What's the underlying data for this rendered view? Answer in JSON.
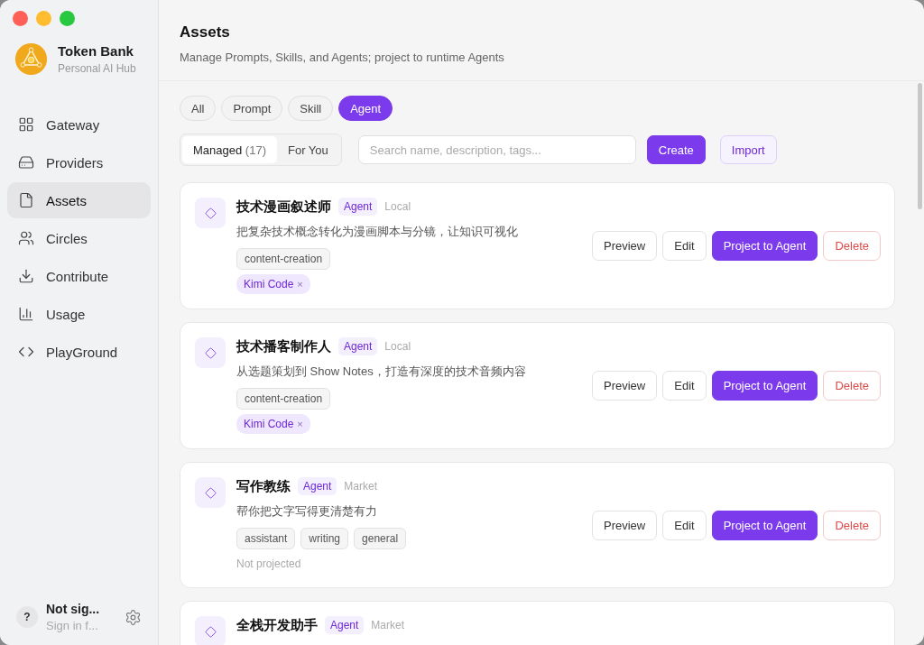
{
  "app": {
    "name": "Token Bank",
    "subtitle": "Personal AI Hub"
  },
  "sidebar": {
    "items": [
      {
        "label": "Gateway",
        "selected": false
      },
      {
        "label": "Providers",
        "selected": false
      },
      {
        "label": "Assets",
        "selected": true
      },
      {
        "label": "Circles",
        "selected": false
      },
      {
        "label": "Contribute",
        "selected": false
      },
      {
        "label": "Usage",
        "selected": false
      },
      {
        "label": "PlayGround",
        "selected": false
      }
    ],
    "user": {
      "avatar": "?",
      "name": "Not sig...",
      "status": "Sign in f..."
    }
  },
  "page": {
    "title": "Assets",
    "subtitle": "Manage Prompts, Skills, and Agents; project to runtime Agents"
  },
  "filters": [
    {
      "label": "All",
      "selected": false
    },
    {
      "label": "Prompt",
      "selected": false
    },
    {
      "label": "Skill",
      "selected": false
    },
    {
      "label": "Agent",
      "selected": true
    }
  ],
  "views": [
    {
      "label": "Managed",
      "count": "(17)",
      "selected": true
    },
    {
      "label": "For You",
      "selected": false
    }
  ],
  "search": {
    "placeholder": "Search name, description, tags..."
  },
  "actions": [
    "Create",
    "Import"
  ],
  "assets": [
    {
      "name": "技术漫画叙述师",
      "type": "Agent",
      "source": "Local",
      "description": "把复杂技术概念转化为漫画脚本与分镜，让知识可视化",
      "tags": [
        {
          "label": "content-creation",
          "kind": "tag"
        },
        {
          "label": "Kimi Code",
          "kind": "target",
          "remove": "×"
        }
      ],
      "buttons": [
        "Preview",
        "Edit",
        "Project to Agent",
        "Delete"
      ]
    },
    {
      "name": "技术播客制作人",
      "type": "Agent",
      "source": "Local",
      "description": "从选题策划到 Show Notes，打造有深度的技术音频内容",
      "tags": [
        {
          "label": "content-creation",
          "kind": "tag"
        },
        {
          "label": "Kimi Code",
          "kind": "target",
          "remove": "×"
        }
      ],
      "buttons": [
        "Preview",
        "Edit",
        "Project to Agent",
        "Delete"
      ]
    },
    {
      "name": "写作教练",
      "type": "Agent",
      "source": "Market",
      "description": "帮你把文字写得更清楚有力",
      "tags": [
        {
          "label": "assistant",
          "kind": "tag"
        },
        {
          "label": "writing",
          "kind": "tag"
        },
        {
          "label": "general",
          "kind": "tag"
        }
      ],
      "status": "Not projected",
      "buttons": [
        "Preview",
        "Edit",
        "Project to Agent",
        "Delete"
      ]
    },
    {
      "name": "全栈开发助手",
      "type": "Agent",
      "source": "Market"
    }
  ]
}
